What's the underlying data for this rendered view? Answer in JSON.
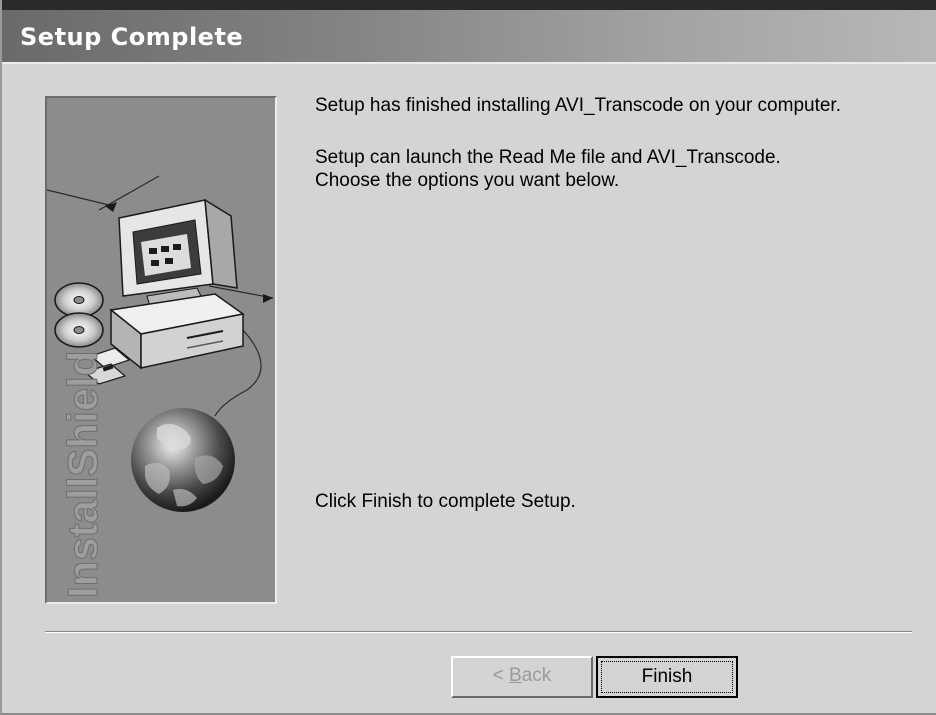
{
  "window": {
    "title": "Setup Complete"
  },
  "side_panel": {
    "brand_text": "InstallShield",
    "icons": [
      "monitor-icon",
      "computer-tower-icon",
      "cd-disc-icon",
      "floppy-disk-icon",
      "globe-icon"
    ]
  },
  "messages": {
    "line1": "Setup has finished installing AVI_Transcode on your computer.",
    "line2": "Setup can launch the Read Me file and AVI_Transcode.",
    "line3": "Choose the options you want below.",
    "line4": "Click Finish to complete Setup."
  },
  "buttons": {
    "back_prefix": "< ",
    "back_accel": "B",
    "back_rest": "ack",
    "back_enabled": false,
    "finish_label": "Finish"
  },
  "colors": {
    "title_text": "#ffffff",
    "face": "#d4d4d4",
    "panel": "#8c8c8c",
    "disabled_text": "#9a9a9a"
  }
}
